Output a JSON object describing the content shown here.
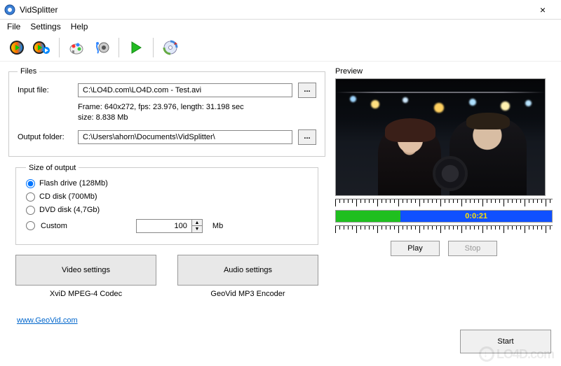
{
  "titlebar": {
    "title": "VidSplitter",
    "close": "×"
  },
  "menu": {
    "file": "File",
    "settings": "Settings",
    "help": "Help"
  },
  "files": {
    "legend": "Files",
    "input_label": "Input file:",
    "input_value": "C:\\LO4D.com\\LO4D.com - Test.avi",
    "browse": "...",
    "info_line1": "Frame: 640x272, fps: 23.976, length: 31.198 sec",
    "info_line2": "size: 8.838 Mb",
    "output_label": "Output folder:",
    "output_value": "C:\\Users\\ahorn\\Documents\\VidSplitter\\"
  },
  "size": {
    "legend": "Size of output",
    "flash": "Flash drive (128Mb)",
    "cd": "CD disk (700Mb)",
    "dvd": "DVD disk (4,7Gb)",
    "custom": "Custom",
    "custom_value": "100",
    "unit": "Mb"
  },
  "buttons": {
    "video_settings": "Video settings",
    "audio_settings": "Audio settings",
    "video_codec": "XviD MPEG-4 Codec",
    "audio_codec": "GeoVid MP3 Encoder"
  },
  "link": "www.GeoVid.com",
  "preview": {
    "label": "Preview",
    "time": "0:0:21",
    "play": "Play",
    "stop": "Stop"
  },
  "start": "Start",
  "watermark": "LO4D.com"
}
